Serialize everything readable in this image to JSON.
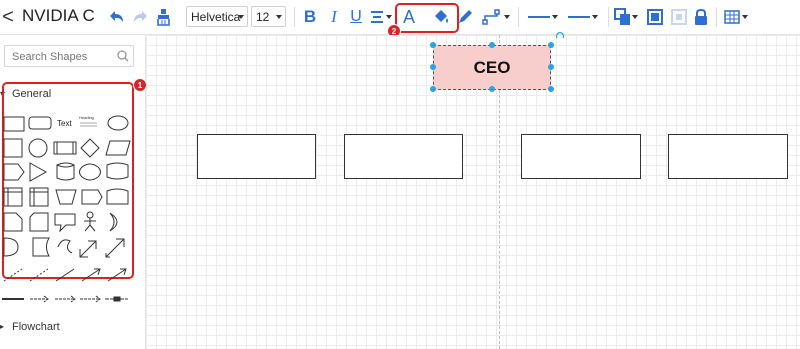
{
  "app": {
    "title": "NVIDIA C",
    "back_label": "<"
  },
  "toolbar": {
    "font_family": "Helvetica",
    "font_size": "12",
    "bold_label": "B",
    "italic_label": "I",
    "underline_label": "U",
    "font_color_label": "A",
    "annotation_2": "2"
  },
  "sidebar": {
    "search_placeholder": "Search Shapes",
    "general_label": "General",
    "flowchart_label": "Flowchart",
    "text_shape_label": "Text",
    "heading_shape_label": "Heading",
    "collapse_label": "«",
    "annotation_1": "1"
  },
  "canvas": {
    "ceo_label": "CEO",
    "ceo_fill": "#f8cecc"
  },
  "colors": {
    "accent": "#2f6fd0",
    "selection_handle": "#29a3e6",
    "annotation_red": "#e02020"
  }
}
